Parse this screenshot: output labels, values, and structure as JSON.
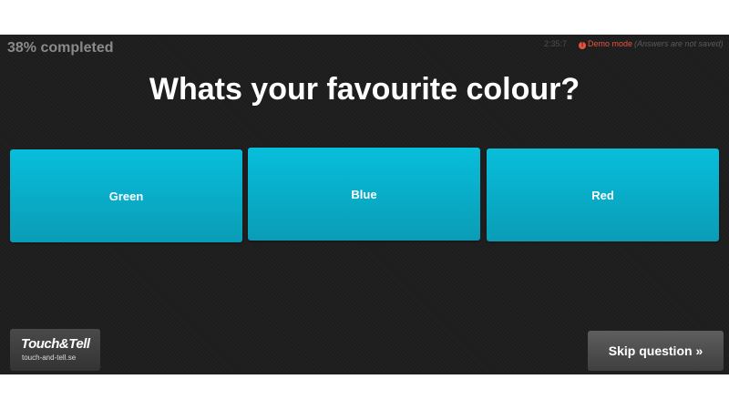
{
  "progress": {
    "percent": 38,
    "label": "38% completed"
  },
  "header": {
    "timer": "2:35:7",
    "demo_label": "Demo mode",
    "demo_note": "(Answers are not saved)"
  },
  "question": {
    "text": "Whats your favourite colour?"
  },
  "answers": [
    {
      "label": "Green"
    },
    {
      "label": "Blue"
    },
    {
      "label": "Red"
    }
  ],
  "footer": {
    "logo_text": "Touch&Tell",
    "logo_url": "touch-and-tell.se",
    "skip_label": "Skip question »"
  },
  "colors": {
    "answer_button": "#09b0cc",
    "background": "#1d1d1d",
    "demo_warning": "#e8533d"
  },
  "icons": {
    "demo": "exclamation-circle-icon"
  }
}
